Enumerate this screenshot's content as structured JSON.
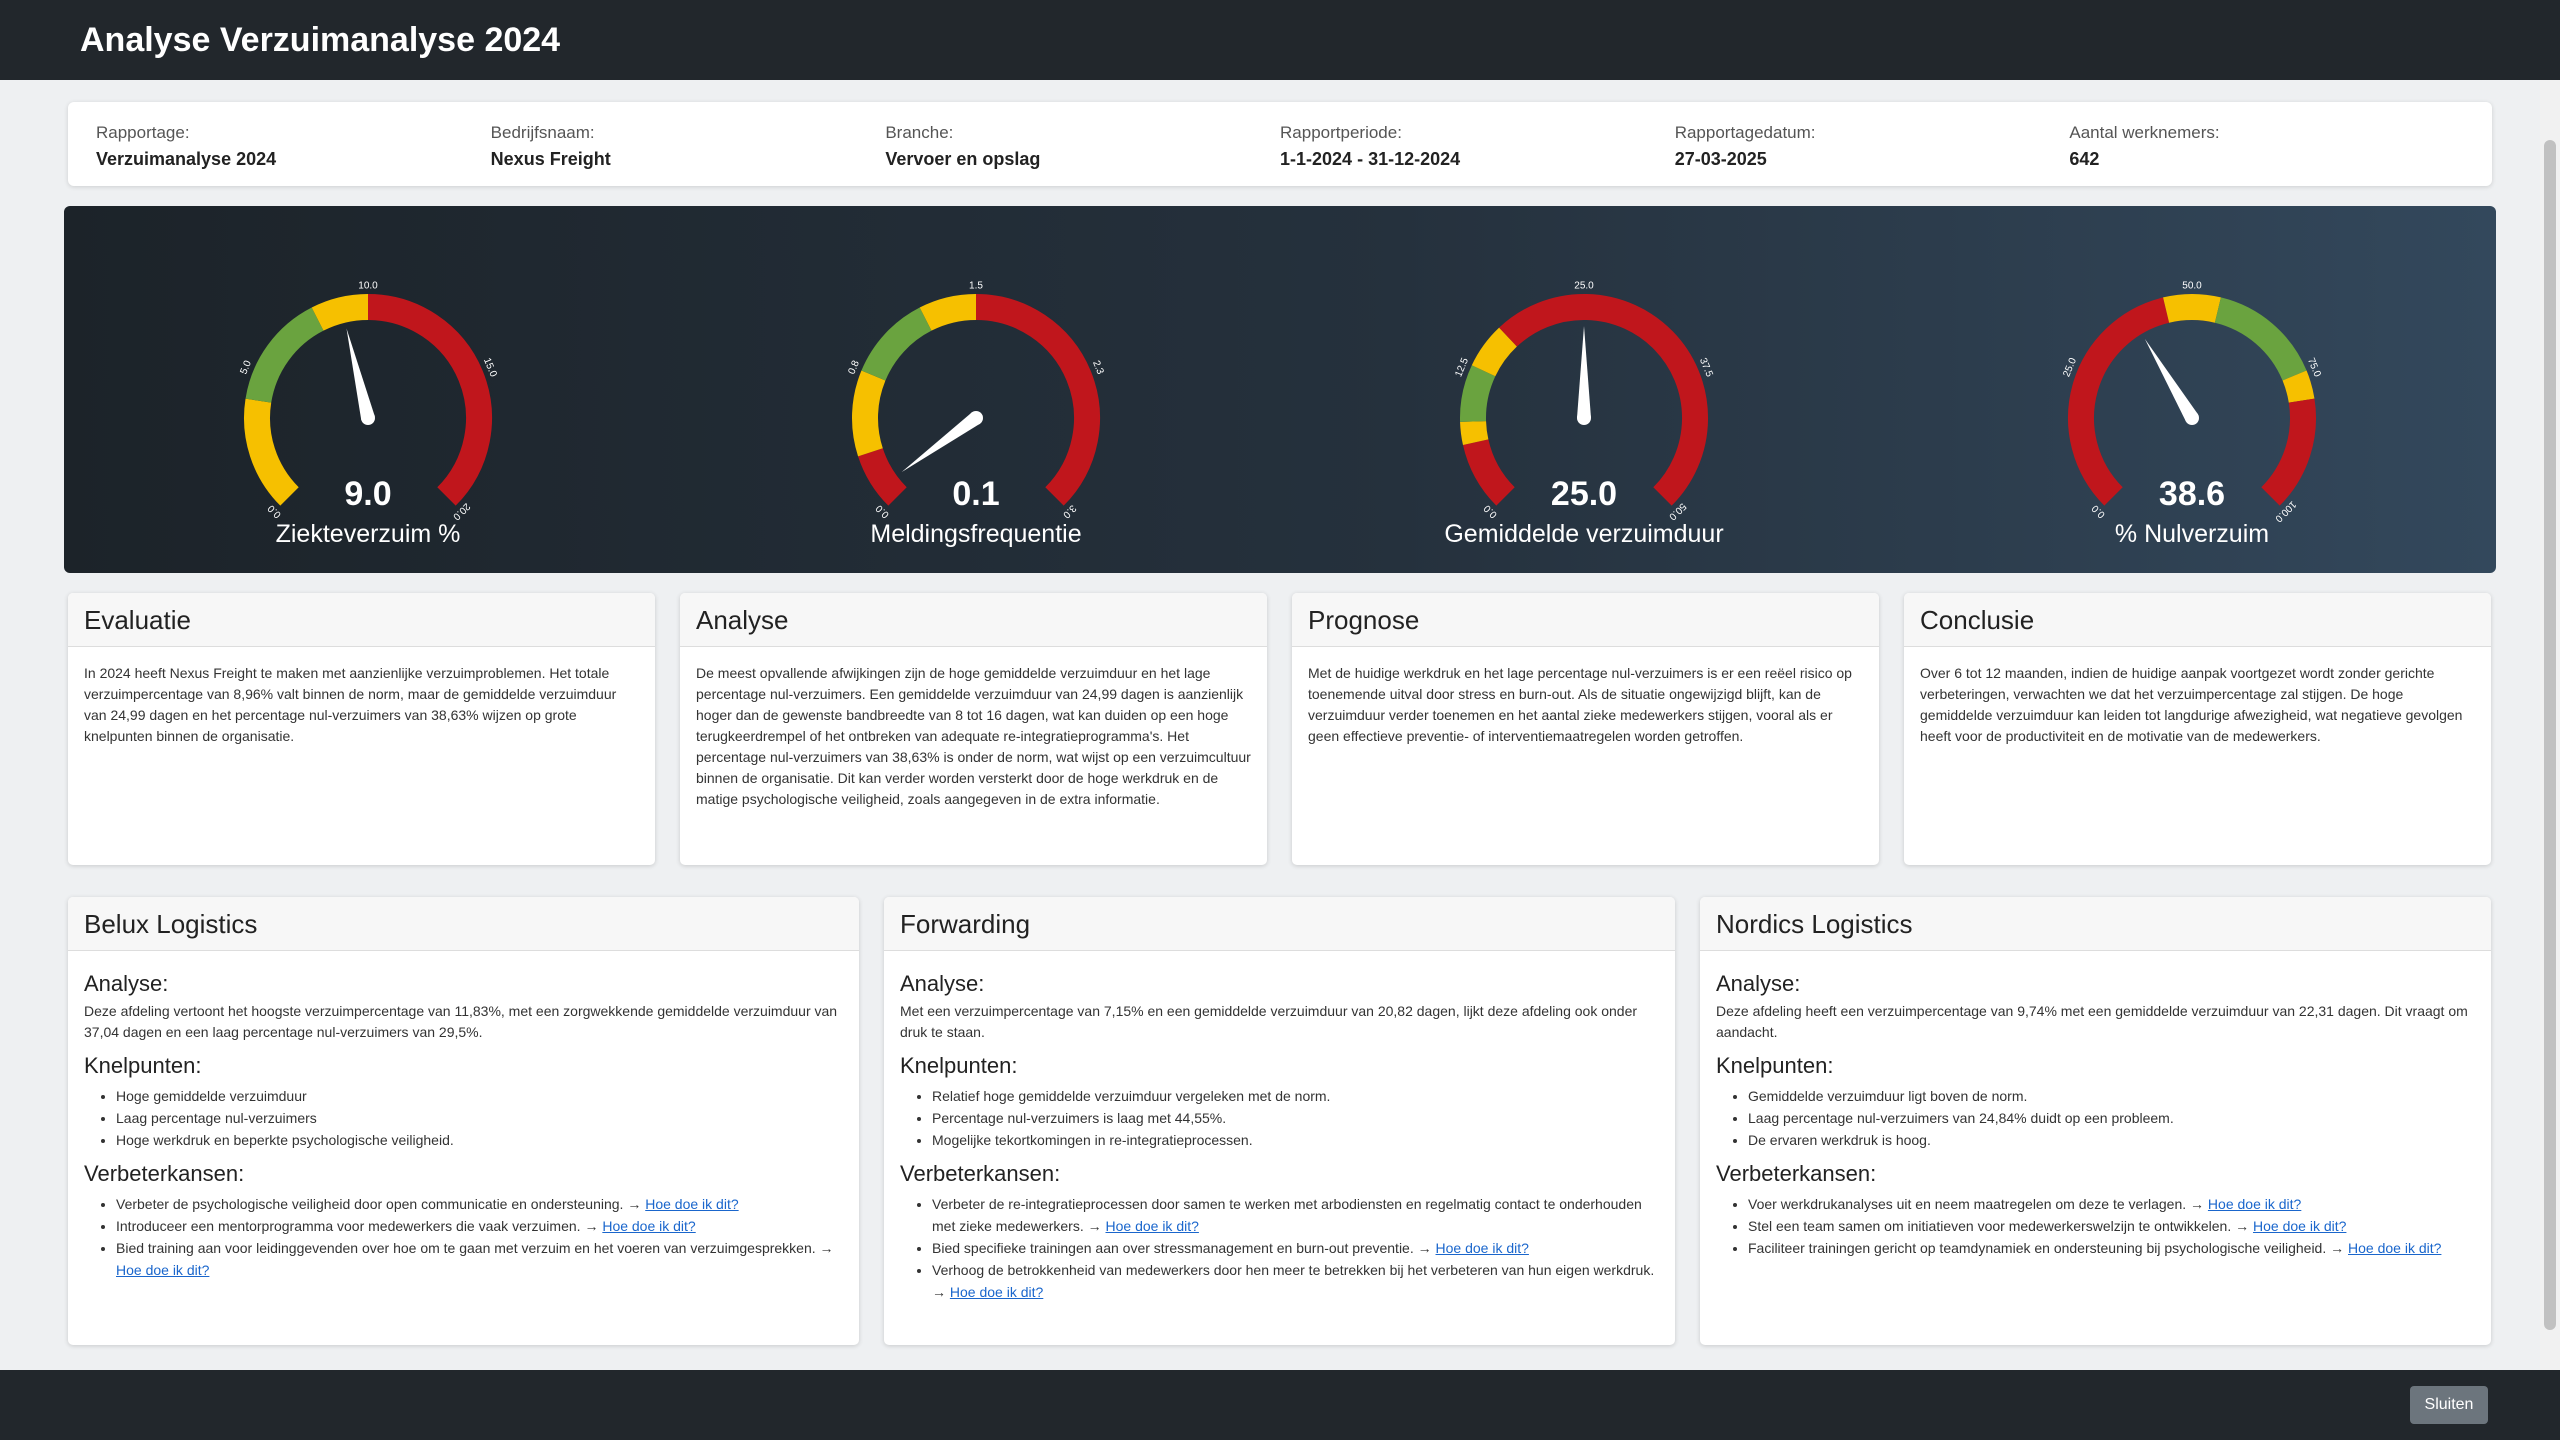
{
  "header": {
    "title": "Analyse Verzuimanalyse 2024"
  },
  "meta": [
    {
      "label": "Rapportage:",
      "value": "Verzuimanalyse 2024"
    },
    {
      "label": "Bedrijfsnaam:",
      "value": "Nexus Freight"
    },
    {
      "label": "Branche:",
      "value": "Vervoer en opslag"
    },
    {
      "label": "Rapportperiode:",
      "value": "1-1-2024 - 31-12-2024"
    },
    {
      "label": "Rapportagedatum:",
      "value": "27-03-2025"
    },
    {
      "label": "Aantal werknemers:",
      "value": "642"
    }
  ],
  "colors": {
    "green": "#6aa33f",
    "yellow": "#f6c000",
    "red": "#c0161c"
  },
  "gauges": [
    {
      "label": "Ziekteverzuim %",
      "value_text": "9.0",
      "value": 9.0,
      "min": 0,
      "max": 20,
      "ticks": [
        "0.0",
        "5.0",
        "10.0",
        "15.0",
        "20.0"
      ],
      "bands": [
        {
          "from": 0,
          "to": 4,
          "color": "yellow"
        },
        {
          "from": 4,
          "to": 8,
          "color": "green"
        },
        {
          "from": 8,
          "to": 10,
          "color": "yellow"
        },
        {
          "from": 10,
          "to": 20,
          "color": "red"
        }
      ]
    },
    {
      "label": "Meldingsfrequentie",
      "value_text": "0.1",
      "value": 0.1,
      "min": 0,
      "max": 3,
      "ticks": [
        "0.0",
        "0.8",
        "1.5",
        "2.3",
        "3.0"
      ],
      "bands": [
        {
          "from": 0,
          "to": 0.3,
          "color": "red"
        },
        {
          "from": 0.3,
          "to": 0.75,
          "color": "yellow"
        },
        {
          "from": 0.75,
          "to": 1.2,
          "color": "green"
        },
        {
          "from": 1.2,
          "to": 1.5,
          "color": "yellow"
        },
        {
          "from": 1.5,
          "to": 3,
          "color": "red"
        }
      ]
    },
    {
      "label": "Gemiddelde verzuimduur",
      "value_text": "25.0",
      "value": 25.0,
      "min": 0,
      "max": 50,
      "ticks": [
        "0.0",
        "12.5",
        "25.0",
        "37.5",
        "50.0"
      ],
      "bands": [
        {
          "from": 0,
          "to": 6,
          "color": "red"
        },
        {
          "from": 6,
          "to": 8,
          "color": "yellow"
        },
        {
          "from": 8,
          "to": 13,
          "color": "green"
        },
        {
          "from": 13,
          "to": 17,
          "color": "yellow"
        },
        {
          "from": 17,
          "to": 50,
          "color": "red"
        }
      ]
    },
    {
      "label": "% Nulverzuim",
      "value_text": "38.6",
      "value": 38.6,
      "min": 0,
      "max": 100,
      "ticks": [
        "0.0",
        "25.0",
        "50.0",
        "75.0",
        "100.0"
      ],
      "bands": [
        {
          "from": 0,
          "to": 45,
          "color": "red"
        },
        {
          "from": 45,
          "to": 55,
          "color": "yellow"
        },
        {
          "from": 55,
          "to": 75,
          "color": "green"
        },
        {
          "from": 75,
          "to": 80,
          "color": "yellow"
        },
        {
          "from": 80,
          "to": 100,
          "color": "red"
        }
      ]
    }
  ],
  "summary": [
    {
      "title": "Evaluatie",
      "text": "In 2024 heeft Nexus Freight te maken met aanzienlijke verzuimproblemen. Het totale verzuimpercentage van 8,96% valt binnen de norm, maar de gemiddelde verzuimduur van 24,99 dagen en het percentage nul-verzuimers van 38,63% wijzen op grote knelpunten binnen de organisatie."
    },
    {
      "title": "Analyse",
      "text": "De meest opvallende afwijkingen zijn de hoge gemiddelde verzuimduur en het lage percentage nul-verzuimers. Een gemiddelde verzuimduur van 24,99 dagen is aanzienlijk hoger dan de gewenste bandbreedte van 8 tot 16 dagen, wat kan duiden op een hoge terugkeerdrempel of het ontbreken van adequate re-integratieprogramma's. Het percentage nul-verzuimers van 38,63% is onder de norm, wat wijst op een verzuimcultuur binnen de organisatie. Dit kan verder worden versterkt door de hoge werkdruk en de matige psychologische veiligheid, zoals aangegeven in de extra informatie."
    },
    {
      "title": "Prognose",
      "text": "Met de huidige werkdruk en het lage percentage nul-verzuimers is er een reëel risico op toenemende uitval door stress en burn-out. Als de situatie ongewijzigd blijft, kan de verzuimduur verder toenemen en het aantal zieke medewerkers stijgen, vooral als er geen effectieve preventie- of interventiemaatregelen worden getroffen."
    },
    {
      "title": "Conclusie",
      "text": "Over 6 tot 12 maanden, indien de huidige aanpak voortgezet wordt zonder gerichte verbeteringen, verwachten we dat het verzuimpercentage zal stijgen. De hoge gemiddelde verzuimduur kan leiden tot langdurige afwezigheid, wat negatieve gevolgen heeft voor de productiviteit en de motivatie van de medewerkers."
    }
  ],
  "labels": {
    "analysis": "Analyse:",
    "bottlenecks": "Knelpunten:",
    "opportunities": "Verbeterkansen:",
    "howto": "Hoe doe ik dit?",
    "arrow": "→"
  },
  "departments": [
    {
      "title": "Belux Logistics",
      "analysis": "Deze afdeling vertoont het hoogste verzuimpercentage van 11,83%, met een zorgwekkende gemiddelde verzuimduur van 37,04 dagen en een laag percentage nul-verzuimers van 29,5%.",
      "bottlenecks": [
        "Hoge gemiddelde verzuimduur",
        "Laag percentage nul-verzuimers",
        "Hoge werkdruk en beperkte psychologische veiligheid."
      ],
      "opportunities": [
        "Verbeter de psychologische veiligheid door open communicatie en ondersteuning.",
        "Introduceer een mentorprogramma voor medewerkers die vaak verzuimen.",
        "Bied training aan voor leidinggevenden over hoe om te gaan met verzuim en het voeren van verzuimgesprekken."
      ]
    },
    {
      "title": "Forwarding",
      "analysis": "Met een verzuimpercentage van 7,15% en een gemiddelde verzuimduur van 20,82 dagen, lijkt deze afdeling ook onder druk te staan.",
      "bottlenecks": [
        "Relatief hoge gemiddelde verzuimduur vergeleken met de norm.",
        "Percentage nul-verzuimers is laag met 44,55%.",
        "Mogelijke tekortkomingen in re-integratieprocessen."
      ],
      "opportunities": [
        "Verbeter de re-integratieprocessen door samen te werken met arbodiensten en regelmatig contact te onderhouden met zieke medewerkers.",
        "Bied specifieke trainingen aan over stressmanagement en burn-out preventie.",
        "Verhoog de betrokkenheid van medewerkers door hen meer te betrekken bij het verbeteren van hun eigen werkdruk."
      ]
    },
    {
      "title": "Nordics Logistics",
      "analysis": "Deze afdeling heeft een verzuimpercentage van 9,74% met een gemiddelde verzuimduur van 22,31 dagen. Dit vraagt om aandacht.",
      "bottlenecks": [
        "Gemiddelde verzuimduur ligt boven de norm.",
        "Laag percentage nul-verzuimers van 24,84% duidt op een probleem.",
        "De ervaren werkdruk is hoog."
      ],
      "opportunities": [
        "Voer werkdrukanalyses uit en neem maatregelen om deze te verlagen.",
        "Stel een team samen om initiatieven voor medewerkerswelzijn te ontwikkelen.",
        "Faciliteer trainingen gericht op teamdynamiek en ondersteuning bij psychologische veiligheid."
      ]
    }
  ],
  "footer": {
    "close_label": "Sluiten"
  }
}
